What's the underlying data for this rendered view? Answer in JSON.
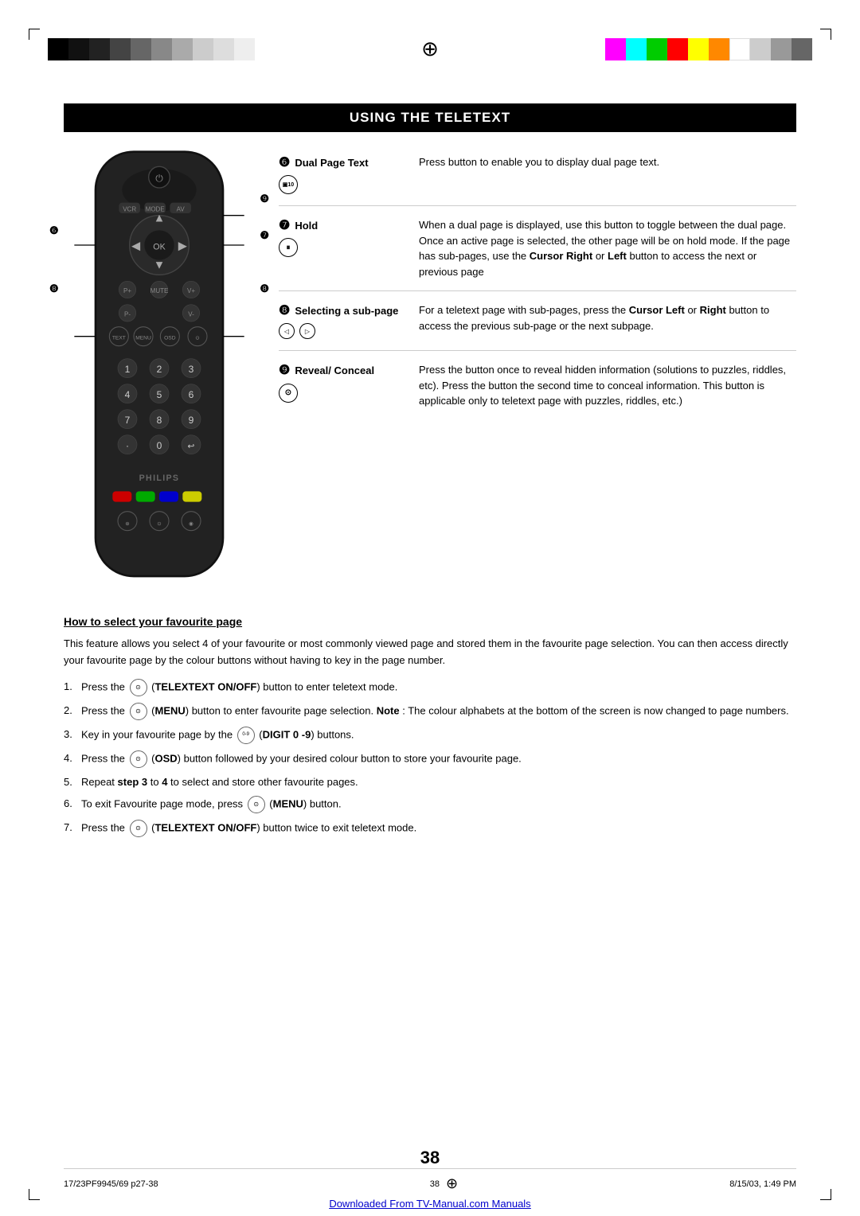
{
  "page": {
    "title": "Using the Teletext",
    "page_number": "38",
    "footer_left": "17/23PF9945/69 p27-38",
    "footer_center": "38",
    "footer_right": "8/15/03, 1:49 PM",
    "bottom_link": "Downloaded From TV-Manual.com Manuals"
  },
  "color_bars": {
    "grayscale": [
      "#000000",
      "#1a1a1a",
      "#333333",
      "#4d4d4d",
      "#666666",
      "#808080",
      "#999999",
      "#b3b3b3",
      "#cccccc",
      "#e6e6e6"
    ],
    "colors": [
      "#ff00ff",
      "#00ffff",
      "#00ff00",
      "#ff0000",
      "#ffff00",
      "#ff8800",
      "#ffffff",
      "#cccccc",
      "#999999",
      "#666666"
    ]
  },
  "annotations": [
    {
      "id": "6",
      "title": "Dual Page Text",
      "icon_label": "10",
      "description": "Press button to enable you to display dual page text."
    },
    {
      "id": "7",
      "title": "Hold",
      "icon_label": "⏸",
      "description": "When a dual page is displayed, use this button to toggle between the dual page.  Once an active page is selected, the other page will be on hold mode.  If the page has sub-pages, use the Cursor Right or Left button to access the next or previous page"
    },
    {
      "id": "8",
      "title": "Selecting a sub-page",
      "icon_left": "◁",
      "icon_right": "▷",
      "description": "For a teletext page with sub-pages, press the Cursor Left or Right button to access the previous sub-page or the next subpage."
    },
    {
      "id": "9",
      "title": "Reveal/ Conceal",
      "icon_label": "⊙",
      "description": "Press the button once to reveal hidden information (solutions to puzzles, riddles, etc). Press the button the second time to conceal information. This button is applicable only to teletext page with puzzles, riddles, etc.)"
    }
  ],
  "favourite": {
    "title": "How to select your favourite page",
    "intro": "This feature allows you select 4 of your favourite or most commonly viewed page and stored them in the favourite page selection. You can then access directly your favourite page by the colour buttons without having to key in the page number.",
    "steps": [
      {
        "num": "1.",
        "icon": "⊙",
        "text_before": "Press the",
        "bold1": "TELEXTEXT ON/OFF",
        "text_after": "button to enter teletext mode."
      },
      {
        "num": "2.",
        "icon": "⊙",
        "text_before": "Press the",
        "bold1": "MENU",
        "text_after": "button to enter favourite page selection.",
        "note": "Note",
        "note_text": ": The colour alphabets at the bottom of the screen is now changed to page numbers."
      },
      {
        "num": "3.",
        "text_before": "Key in your favourite page by the",
        "bold1": "DIGIT 0 -9",
        "text_after": "buttons."
      },
      {
        "num": "4.",
        "icon": "⊙",
        "text_before": "Press the",
        "bold1": "OSD",
        "text_after": "button followed by your desired colour button to store your favourite page."
      },
      {
        "num": "5.",
        "text": "Repeat",
        "bold1": "step 3",
        "text2": "to",
        "bold2": "4",
        "text3": "to select and store other favourite pages."
      },
      {
        "num": "6.",
        "text_before": "To exit Favourite page mode, press",
        "icon": "⊙",
        "bold1": "MENU",
        "text_after": "button."
      },
      {
        "num": "7.",
        "text_before": "Press the",
        "icon": "⊙",
        "bold1": "TELEXTEXT ON/OFF",
        "text_after": "button twice to exit teletext mode."
      }
    ]
  }
}
